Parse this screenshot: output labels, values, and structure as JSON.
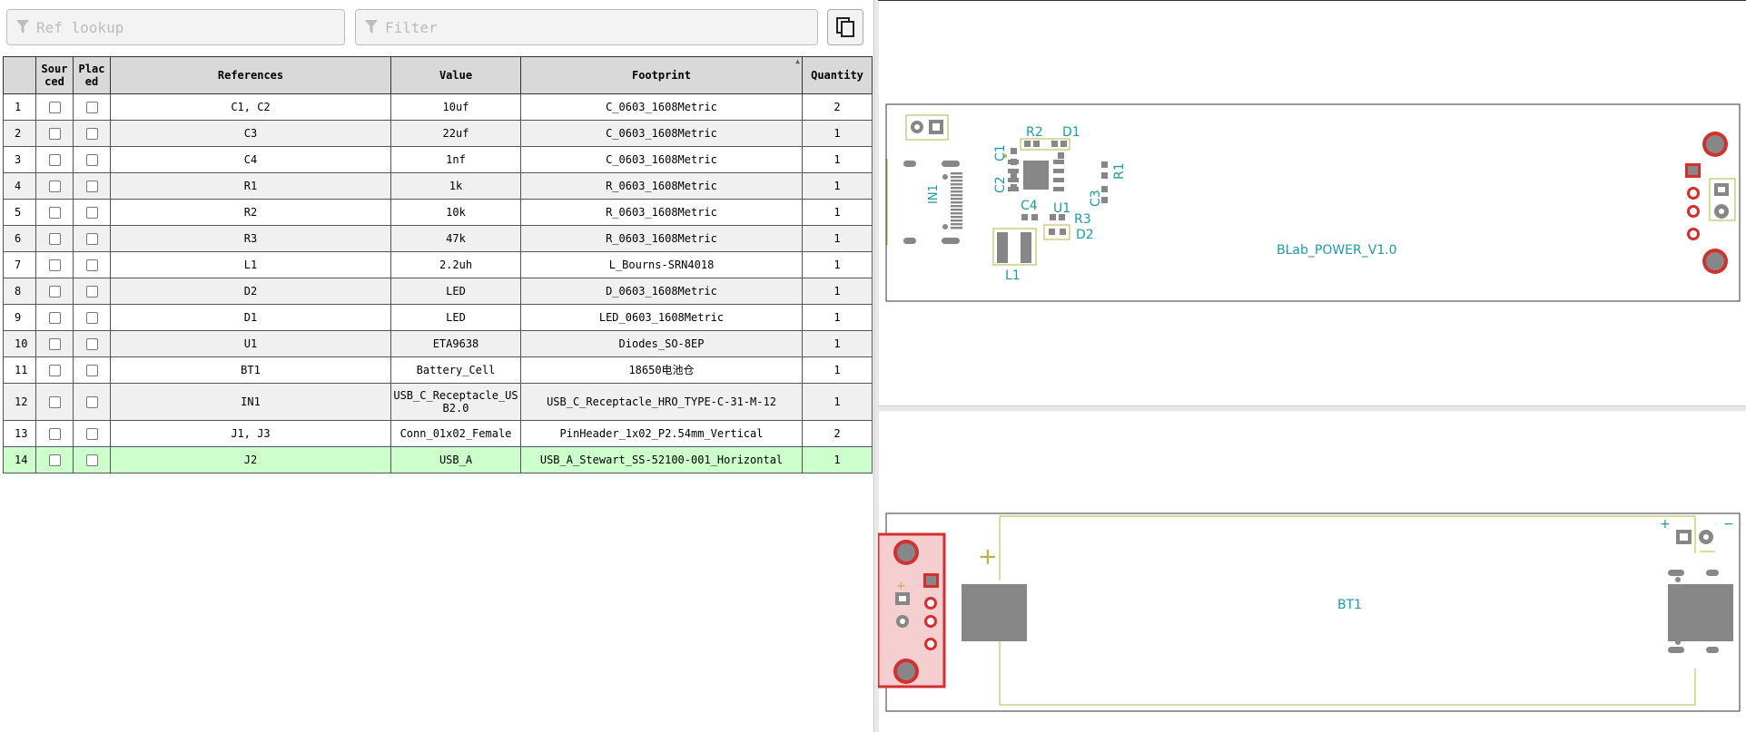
{
  "toolbar": {
    "ref_lookup_placeholder": "Ref lookup",
    "filter_placeholder": "Filter"
  },
  "table": {
    "headers": {
      "index": "",
      "sourced": "Sourced",
      "placed": "Placed",
      "references": "References",
      "value": "Value",
      "footprint": "Footprint",
      "quantity": "Quantity"
    },
    "rows": [
      {
        "n": "1",
        "refs": "C1, C2",
        "value": "10uf",
        "footprint": "C_0603_1608Metric",
        "qty": "2"
      },
      {
        "n": "2",
        "refs": "C3",
        "value": "22uf",
        "footprint": "C_0603_1608Metric",
        "qty": "1"
      },
      {
        "n": "3",
        "refs": "C4",
        "value": "1nf",
        "footprint": "C_0603_1608Metric",
        "qty": "1"
      },
      {
        "n": "4",
        "refs": "R1",
        "value": "1k",
        "footprint": "R_0603_1608Metric",
        "qty": "1"
      },
      {
        "n": "5",
        "refs": "R2",
        "value": "10k",
        "footprint": "R_0603_1608Metric",
        "qty": "1"
      },
      {
        "n": "6",
        "refs": "R3",
        "value": "47k",
        "footprint": "R_0603_1608Metric",
        "qty": "1"
      },
      {
        "n": "7",
        "refs": "L1",
        "value": "2.2uh",
        "footprint": "L_Bourns-SRN4018",
        "qty": "1"
      },
      {
        "n": "8",
        "refs": "D2",
        "value": "LED",
        "footprint": "D_0603_1608Metric",
        "qty": "1"
      },
      {
        "n": "9",
        "refs": "D1",
        "value": "LED",
        "footprint": "LED_0603_1608Metric",
        "qty": "1"
      },
      {
        "n": "10",
        "refs": "U1",
        "value": "ETA9638",
        "footprint": "Diodes_SO-8EP",
        "qty": "1"
      },
      {
        "n": "11",
        "refs": "BT1",
        "value": "Battery_Cell",
        "footprint": "18650电池仓",
        "qty": "1"
      },
      {
        "n": "12",
        "refs": "IN1",
        "value": "USB_C_Receptacle_USB2.0",
        "footprint": "USB_C_Receptacle_HRO_TYPE-C-31-M-12",
        "qty": "1"
      },
      {
        "n": "13",
        "refs": "J1, J3",
        "value": "Conn_01x02_Female",
        "footprint": "PinHeader_1x02_P2.54mm_Vertical",
        "qty": "2"
      },
      {
        "n": "14",
        "refs": "J2",
        "value": "USB_A",
        "footprint": "USB_A_Stewart_SS-52100-001_Horizontal",
        "qty": "1"
      }
    ]
  },
  "front_view": {
    "board_label": "BLab_POWER_V1.0",
    "labels": {
      "r2": "R2",
      "d1": "D1",
      "c1": "C1",
      "c2": "C2",
      "r1": "R1",
      "in1": "IN1",
      "c4": "C4",
      "u1": "U1",
      "r3": "R3",
      "c3": "C3",
      "d2": "D2",
      "l1": "L1"
    }
  },
  "back_view": {
    "label": "BT1",
    "plus": "+",
    "minus": "−"
  },
  "colors": {
    "silk": "#1e9aa6",
    "outline": "#b5b54a",
    "pad": "#878787",
    "highlight": "#d32f2f",
    "highlight_row": "#ccffcc"
  },
  "icons": {
    "filter": "filter-icon",
    "copy": "copy-icon"
  }
}
